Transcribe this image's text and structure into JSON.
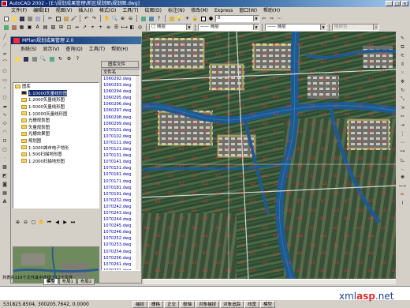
{
  "window": {
    "title": "AutoCAD 2002 - [E:\\规划成果管理\\新区规划图\\规划图.dwg]",
    "controls": [
      "_",
      "□",
      "×"
    ]
  },
  "menubar": [
    "文件(F)",
    "编辑(E)",
    "视图(V)",
    "插入(I)",
    "格式(O)",
    "工具(T)",
    "绘图(D)",
    "标注(N)",
    "修改(M)",
    "Express",
    "窗口(W)",
    "帮助(H)"
  ],
  "toolbar": {
    "layer_combo": "0",
    "color_combo": "□ 随层",
    "linetype_combo": "—— 随层",
    "lineweight_combo": "—— 随层",
    "plot_style_combo": "随颜色"
  },
  "panel": {
    "title": "MPlan规划成果管理 2.0",
    "menu": [
      "系统(S)",
      "显示(V)",
      "查询(Q)",
      "工具(T)",
      "帮助(H)"
    ],
    "filelist_tab": "图库文件",
    "filelist_header": "文件名",
    "tree": [
      {
        "label": "图库",
        "level": 0,
        "selected": false
      },
      {
        "label": "1:10000矢量线形图",
        "level": 1,
        "selected": true
      },
      {
        "label": "1:2000矢量线形图",
        "level": 1,
        "selected": false
      },
      {
        "label": "1:5000矢量线形图",
        "level": 1,
        "selected": false
      },
      {
        "label": "1:10000矢量线形图",
        "level": 1,
        "selected": false
      },
      {
        "label": "光栅规划图",
        "level": 1,
        "selected": false
      },
      {
        "label": "矢量规划图",
        "level": 1,
        "selected": false
      },
      {
        "label": "光栅效果图",
        "level": 1,
        "selected": false
      },
      {
        "label": "规划图",
        "level": 1,
        "selected": false
      },
      {
        "label": "1:1000城市电子地形",
        "level": 1,
        "selected": false
      },
      {
        "label": "1:500扫描地形图",
        "level": 1,
        "selected": false
      },
      {
        "label": "1:2000扫描地形图",
        "level": 1,
        "selected": false
      }
    ],
    "files": [
      "1060292.dwg",
      "1060293.dwg",
      "1060294.dwg",
      "1060295.dwg",
      "1060296.dwg",
      "1060297.dwg",
      "1060298.dwg",
      "1060299.dwg",
      "1070101.dwg",
      "1070102.dwg",
      "1070111.dwg",
      "1070121.dwg",
      "1070131.dwg",
      "1070141.dwg",
      "1070151.dwg",
      "1070161.dwg",
      "1070171.dwg",
      "1070181.dwg",
      "1070191.dwg",
      "1070232.dwg",
      "1070242.dwg",
      "1070243.dwg",
      "1070244.dwg",
      "1070245.dwg",
      "1070246.dwg",
      "1070252.dwg",
      "1070253.dwg",
      "1070254.dwg",
      "1070256.dwg",
      "1070261.dwg",
      "1070271.dwg"
    ],
    "status": "列表共119个文件其中选择了12个文件"
  },
  "layout_tabs": [
    "模型",
    "布局1",
    "布局2"
  ],
  "statusbar": {
    "coords": "531825.8504, 300205.7642, 0.0000",
    "buttons": [
      "捕捉",
      "栅格",
      "正交",
      "极轴",
      "对象捕捉",
      "对象追踪",
      "线宽",
      "模型"
    ]
  },
  "watermark": {
    "prefix": "xml",
    "highlight": "asp",
    "suffix": ".net"
  },
  "colors": {
    "title_active": "#0a246a",
    "chrome": "#d4d0c8",
    "river": "#1e5a8f",
    "labels": "#ff2b2b"
  }
}
